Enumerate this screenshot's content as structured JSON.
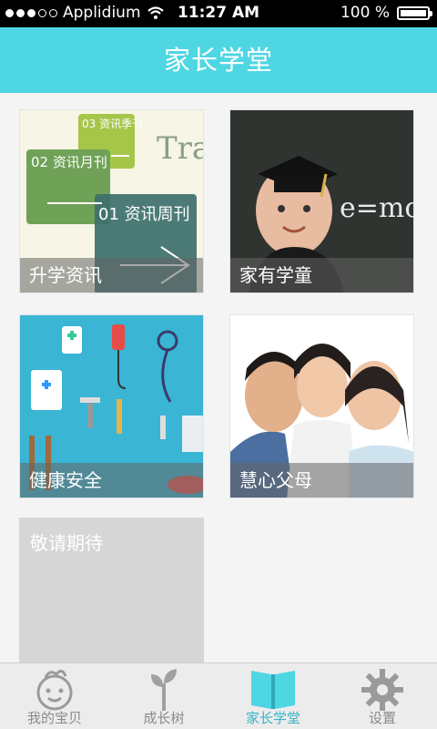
{
  "status": {
    "carrier": "Applidium",
    "time": "11:27 AM",
    "battery": "100 %",
    "signal_bars": 3
  },
  "header": {
    "title": "家长学堂"
  },
  "tiles": [
    {
      "label": "升学资讯",
      "image": "newsletter-image",
      "image_text": [
        "03 资讯季刊",
        "02 资讯月刊",
        "01 资讯周刊",
        "Trade"
      ]
    },
    {
      "label": "家有学童",
      "image": "graduate-child-image",
      "image_text": [
        "e=mc"
      ]
    },
    {
      "label": "健康安全",
      "image": "medical-icons-image"
    },
    {
      "label": "慧心父母",
      "image": "family-photo-image"
    },
    {
      "label": "敬请期待",
      "image": "placeholder"
    }
  ],
  "tabbar": {
    "items": [
      {
        "label": "我的宝贝",
        "icon": "baby-face-icon",
        "active": false
      },
      {
        "label": "成长树",
        "icon": "sprout-icon",
        "active": false
      },
      {
        "label": "家长学堂",
        "icon": "book-icon",
        "active": true
      },
      {
        "label": "设置",
        "icon": "gear-icon",
        "active": false
      }
    ]
  },
  "colors": {
    "header": "#4fd6e3",
    "active_tab": "#34b5c8",
    "placeholder_tile": "#d6d6d6"
  }
}
